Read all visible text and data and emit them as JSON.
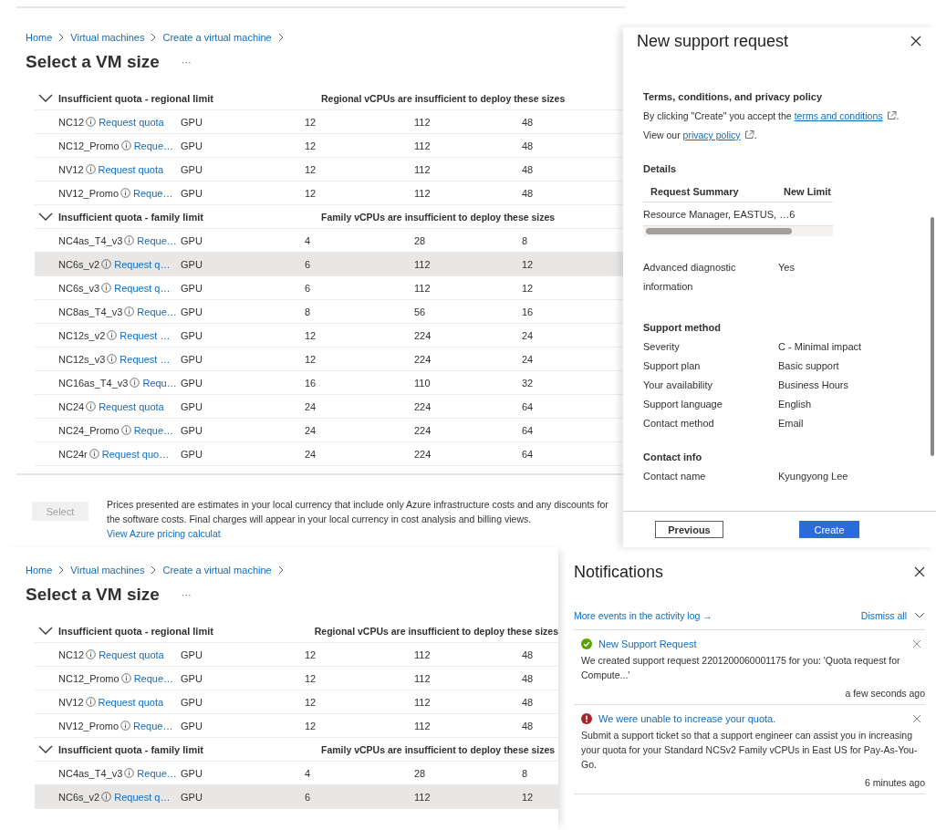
{
  "upper": {
    "breadcrumb": [
      "Home",
      "Virtual machines",
      "Create a virtual machine"
    ],
    "title": "Select a VM size",
    "more": "···",
    "groups": [
      {
        "label": "Insufficient quota - regional limit",
        "message": "Regional vCPUs are insufficient to deploy these sizes",
        "expanded": true,
        "rows": [
          {
            "size": "NC12",
            "link": "Request quota",
            "type": "GPU",
            "column_4": "12",
            "column_5": "112",
            "column_6": "48",
            "selected": false
          },
          {
            "size": "NC12_Promo",
            "link": "Reque…",
            "type": "GPU",
            "column_4": "12",
            "column_5": "112",
            "column_6": "48",
            "selected": false
          },
          {
            "size": "NV12",
            "link": "Request quota",
            "type": "GPU",
            "column_4": "12",
            "column_5": "112",
            "column_6": "48",
            "selected": false
          },
          {
            "size": "NV12_Promo",
            "link": "Reque…",
            "type": "GPU",
            "column_4": "12",
            "column_5": "112",
            "column_6": "48",
            "selected": false
          }
        ]
      },
      {
        "label": "Insufficient quota - family limit",
        "message": "Family vCPUs are insufficient to deploy these sizes",
        "expanded": true,
        "rows": [
          {
            "size": "NC4as_T4_v3",
            "link": "Reque…",
            "type": "GPU",
            "column_4": "4",
            "column_5": "28",
            "column_6": "8",
            "selected": false
          },
          {
            "size": "NC6s_v2",
            "link": "Request q…",
            "type": "GPU",
            "column_4": "6",
            "column_5": "112",
            "column_6": "12",
            "selected": true
          },
          {
            "size": "NC6s_v3",
            "link": "Request q…",
            "type": "GPU",
            "column_4": "6",
            "column_5": "112",
            "column_6": "12",
            "selected": false
          },
          {
            "size": "NC8as_T4_v3",
            "link": "Reque…",
            "type": "GPU",
            "column_4": "8",
            "column_5": "56",
            "column_6": "16",
            "selected": false
          },
          {
            "size": "NC12s_v2",
            "link": "Request …",
            "type": "GPU",
            "column_4": "12",
            "column_5": "224",
            "column_6": "24",
            "selected": false
          },
          {
            "size": "NC12s_v3",
            "link": "Request …",
            "type": "GPU",
            "column_4": "12",
            "column_5": "224",
            "column_6": "24",
            "selected": false
          },
          {
            "size": "NC16as_T4_v3",
            "link": "Requ…",
            "type": "GPU",
            "column_4": "16",
            "column_5": "110",
            "column_6": "32",
            "selected": false
          },
          {
            "size": "NC24",
            "link": "Request quota",
            "type": "GPU",
            "column_4": "24",
            "column_5": "224",
            "column_6": "64",
            "selected": false
          },
          {
            "size": "NC24_Promo",
            "link": "Reque…",
            "type": "GPU",
            "column_4": "24",
            "column_5": "224",
            "column_6": "64",
            "selected": false
          },
          {
            "size": "NC24r",
            "link": "Request quo…",
            "type": "GPU",
            "column_4": "24",
            "column_5": "224",
            "column_6": "64",
            "selected": false
          }
        ]
      }
    ],
    "footer": {
      "button": {
        "label": "Select",
        "disabled": true
      },
      "note": "Prices presented are estimates in your local currency that include only Azure infrastructure costs and any discounts for the software costs. Final charges will appear in your local currency in cost analysis and billing views.",
      "note_link": "View Azure pricing calculat"
    }
  },
  "support_request": {
    "title": "New support request",
    "terms": {
      "heading": "Terms, conditions, and privacy policy",
      "lines": [
        {
          "before": "By clicking \"Create\" you accept the",
          "link": "terms and conditions",
          "after": "."
        },
        {
          "before": "View our",
          "link": "privacy policy",
          "after": "."
        }
      ]
    },
    "details": {
      "heading": "Details",
      "columns": [
        "Request Summary",
        "New Limit"
      ],
      "rows": [
        [
          "Resource Manager, EASTUS, …",
          "6"
        ]
      ],
      "fields": [
        {
          "label": "Advanced diagnostic information",
          "value": "Yes"
        }
      ]
    },
    "support_method": {
      "heading": "Support method",
      "fields": [
        {
          "label": "Severity",
          "value": "C - Minimal impact"
        },
        {
          "label": "Support plan",
          "value": "Basic support"
        },
        {
          "label": "Your availability",
          "value": "Business Hours"
        },
        {
          "label": "Support language",
          "value": "English"
        },
        {
          "label": "Contact method",
          "value": "Email"
        }
      ]
    },
    "contact_info": {
      "heading": "Contact info",
      "fields": [
        {
          "label": "Contact name",
          "value": "Kyungyong Lee"
        }
      ]
    },
    "buttons": [
      {
        "label": "Previous",
        "kind": "secondary"
      },
      {
        "label": "Create",
        "kind": "primary"
      }
    ]
  },
  "lower": {
    "breadcrumb": [
      "Home",
      "Virtual machines",
      "Create a virtual machine"
    ],
    "title": "Select a VM size",
    "more": "···",
    "groups": [
      {
        "label": "Insufficient quota - regional limit",
        "message": "Regional vCPUs are insufficient to deploy these sizes",
        "expanded": true,
        "rows": [
          {
            "size": "NC12",
            "link": "Request quota",
            "type": "GPU",
            "column_4": "12",
            "column_5": "112",
            "column_6": "48",
            "selected": false
          },
          {
            "size": "NC12_Promo",
            "link": "Reque…",
            "type": "GPU",
            "column_4": "12",
            "column_5": "112",
            "column_6": "48",
            "selected": false
          },
          {
            "size": "NV12",
            "link": "Request quota",
            "type": "GPU",
            "column_4": "12",
            "column_5": "112",
            "column_6": "48",
            "selected": false
          },
          {
            "size": "NV12_Promo",
            "link": "Reque…",
            "type": "GPU",
            "column_4": "12",
            "column_5": "112",
            "column_6": "48",
            "selected": false
          }
        ]
      },
      {
        "label": "Insufficient quota - family limit",
        "message": "Family vCPUs are insufficient to deploy these sizes",
        "expanded": true,
        "rows": [
          {
            "size": "NC4as_T4_v3",
            "link": "Reque…",
            "type": "GPU",
            "column_4": "4",
            "column_5": "28",
            "column_6": "8",
            "selected": false
          },
          {
            "size": "NC6s_v2",
            "link": "Request q…",
            "type": "GPU",
            "column_4": "6",
            "column_5": "112",
            "column_6": "12",
            "selected": true
          }
        ]
      }
    ]
  },
  "notifications": {
    "title": "Notifications",
    "activity_link": "More events in the activity log →",
    "dismiss": "Dismiss all",
    "items": [
      {
        "kind": "success",
        "title": "New Support Request",
        "body": "We created support request 2201200060001175 for you: 'Quota request for Compute...'",
        "time": "a few seconds ago"
      },
      {
        "kind": "error",
        "title": "We were unable to increase your quota.",
        "body": "Submit a support ticket so that a support engineer can assist you in increasing your quota for your Standard NCSv2 Family vCPUs in East US for Pay-As-You-Go.",
        "time": "6 minutes ago"
      }
    ]
  }
}
